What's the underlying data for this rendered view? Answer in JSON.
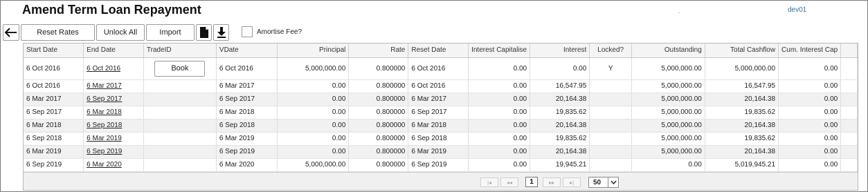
{
  "page": {
    "title": "Amend Term Loan Repayment",
    "user": "dev01",
    "dot": "."
  },
  "toolbar": {
    "reset_rates": "Reset Rates",
    "unlock_all": "Unlock All",
    "import": "Import",
    "amortise_fee_label": "Amortise Fee?"
  },
  "grid": {
    "columns": [
      "Start Date",
      "End Date",
      "TradeID",
      "VDate",
      "Principal",
      "Rate",
      "Reset Date",
      "Interest Capitalise",
      "Interest",
      "Locked?",
      "Outstanding",
      "Total Cashflow",
      "Cum. Interest Cap"
    ],
    "book_label": "Book",
    "rows": [
      {
        "start": "6 Oct 2016",
        "end": "6 Oct 2016",
        "trade": "",
        "vdate": "6 Oct 2016",
        "principal": "5,000,000.00",
        "rate": "0.800000",
        "reset": "6 Oct 2016",
        "intcap": "0.00",
        "interest": "0.00",
        "locked": "Y",
        "outstanding": "5,000,000.00",
        "total": "5,000,000.00",
        "cum": "0.00"
      },
      {
        "start": "6 Oct 2016",
        "end": "6 Mar 2017",
        "trade": "",
        "vdate": "6 Mar 2017",
        "principal": "0.00",
        "rate": "0.800000",
        "reset": "6 Oct 2016",
        "intcap": "0.00",
        "interest": "16,547.95",
        "locked": "",
        "outstanding": "5,000,000.00",
        "total": "16,547.95",
        "cum": "0.00"
      },
      {
        "start": "6 Mar 2017",
        "end": "6 Sep 2017",
        "trade": "",
        "vdate": "6 Sep 2017",
        "principal": "0.00",
        "rate": "0.800000",
        "reset": "6 Mar 2017",
        "intcap": "0.00",
        "interest": "20,164.38",
        "locked": "",
        "outstanding": "5,000,000.00",
        "total": "20,164.38",
        "cum": "0.00"
      },
      {
        "start": "6 Sep 2017",
        "end": "6 Mar 2018",
        "trade": "",
        "vdate": "6 Mar 2018",
        "principal": "0.00",
        "rate": "0.800000",
        "reset": "6 Sep 2017",
        "intcap": "0.00",
        "interest": "19,835.62",
        "locked": "",
        "outstanding": "5,000,000.00",
        "total": "19,835.62",
        "cum": "0.00"
      },
      {
        "start": "6 Mar 2018",
        "end": "6 Sep 2018",
        "trade": "",
        "vdate": "6 Sep 2018",
        "principal": "0.00",
        "rate": "0.800000",
        "reset": "6 Mar 2018",
        "intcap": "0.00",
        "interest": "20,164.38",
        "locked": "",
        "outstanding": "5,000,000.00",
        "total": "20,164.38",
        "cum": "0.00"
      },
      {
        "start": "6 Sep 2018",
        "end": "6 Mar 2019",
        "trade": "",
        "vdate": "6 Mar 2019",
        "principal": "0.00",
        "rate": "0.800000",
        "reset": "6 Sep 2018",
        "intcap": "0.00",
        "interest": "19,835.62",
        "locked": "",
        "outstanding": "5,000,000.00",
        "total": "19,835.62",
        "cum": "0.00"
      },
      {
        "start": "6 Mar 2019",
        "end": "6 Sep 2019",
        "trade": "",
        "vdate": "6 Sep 2019",
        "principal": "0.00",
        "rate": "0.800000",
        "reset": "6 Mar 2019",
        "intcap": "0.00",
        "interest": "20,164.38",
        "locked": "",
        "outstanding": "5,000,000.00",
        "total": "20,164.38",
        "cum": "0.00"
      },
      {
        "start": "6 Sep 2019",
        "end": "6 Mar 2020",
        "trade": "",
        "vdate": "6 Mar 2020",
        "principal": "5,000,000.00",
        "rate": "0.800000",
        "reset": "6 Sep 2019",
        "intcap": "0.00",
        "interest": "19,945.21",
        "locked": "",
        "outstanding": "0.00",
        "total": "5,019,945.21",
        "cum": "0.00"
      }
    ]
  },
  "pager": {
    "first": "|◂",
    "prev": "◂◂",
    "current": "1",
    "next": "▸▸",
    "last": "▸|",
    "page_size": "50"
  },
  "colors": {
    "header_bg": "#f4f4f4",
    "alt_row": "#f1f1f1",
    "user_link": "#2b6fa8"
  }
}
